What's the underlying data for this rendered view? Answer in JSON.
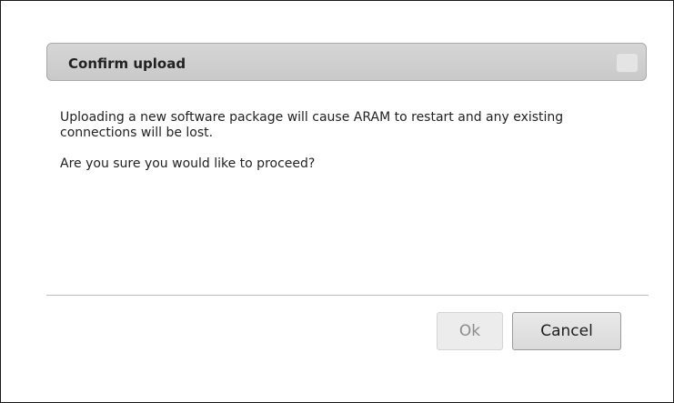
{
  "dialog": {
    "title": "Confirm upload",
    "message": "Uploading a new software package will cause ARAM to restart and any existing connections will be lost.",
    "question": "Are you sure you would like to proceed?",
    "ok_label": "Ok",
    "cancel_label": "Cancel",
    "ok_enabled": false
  },
  "colors": {
    "titlebar": "#cecece",
    "disabled_text": "#8c8c8c"
  }
}
